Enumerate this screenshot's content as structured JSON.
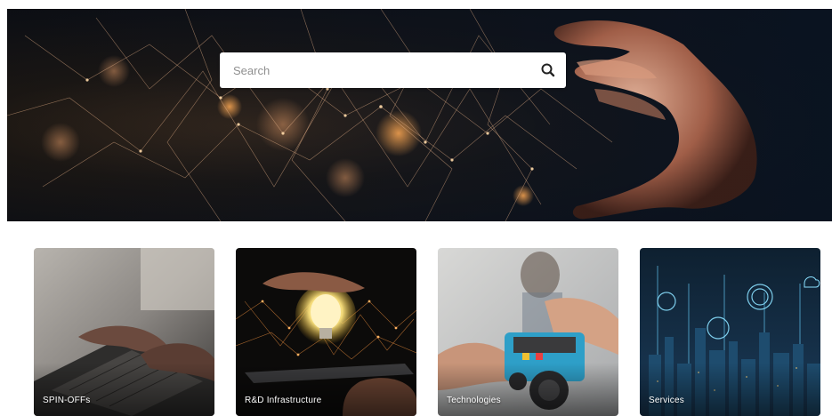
{
  "search": {
    "placeholder": "Search",
    "value": "",
    "icon": "search-icon"
  },
  "hero": {
    "image": "network-hand-image"
  },
  "cards": [
    {
      "label": "SPIN-OFFs",
      "image": "typing-laptop-image"
    },
    {
      "label": "R&D Infrastructure",
      "image": "lightbulb-tablet-image"
    },
    {
      "label": "Technologies",
      "image": "robot-kit-image"
    },
    {
      "label": "Services",
      "image": "smart-city-image"
    }
  ],
  "colors": {
    "hero_dark": "#0d0f14",
    "hero_glow": "#d48a4a",
    "card_label": "#ffffff"
  }
}
